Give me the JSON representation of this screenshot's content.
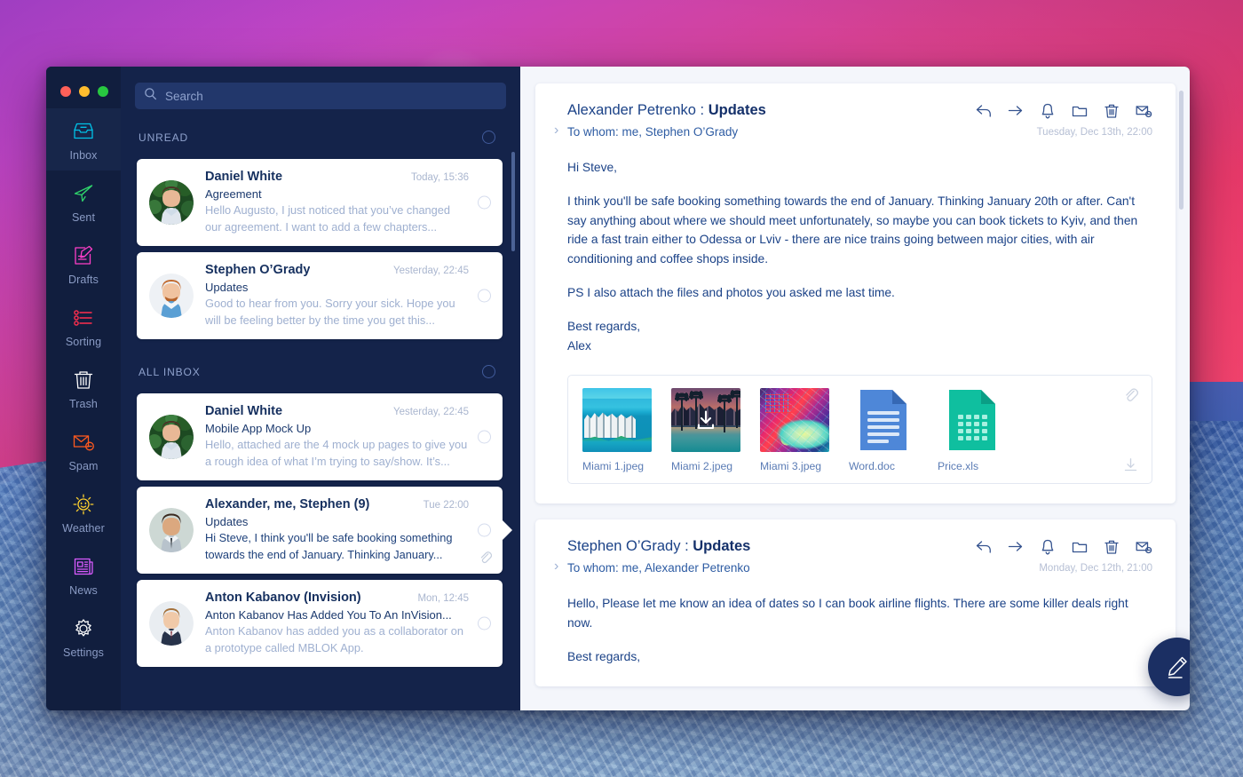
{
  "window": {
    "traffic_lights": [
      "close",
      "minimize",
      "zoom"
    ],
    "colors": {
      "sidebar_bg": "#111e3e",
      "list_bg": "#14234a",
      "reading_bg": "#f4f6fb",
      "accent_inbox": "#00c2e8",
      "accent_sent": "#2fd36b",
      "accent_drafts": "#ff3ec8",
      "accent_sorting": "#ff2e4e",
      "accent_trash": "#ffffff",
      "accent_spam": "#ff5a1f",
      "accent_weather": "#ffd22e",
      "accent_news": "#d95aff",
      "accent_settings": "#ffffff",
      "fab_bg": "#1b2f63"
    }
  },
  "sidebar": {
    "items": [
      {
        "label": "Inbox",
        "icon": "inbox-icon",
        "active": true
      },
      {
        "label": "Sent",
        "icon": "sent-icon",
        "active": false
      },
      {
        "label": "Drafts",
        "icon": "drafts-icon",
        "active": false
      },
      {
        "label": "Sorting",
        "icon": "sorting-icon",
        "active": false
      },
      {
        "label": "Trash",
        "icon": "trash-icon",
        "active": false
      },
      {
        "label": "Spam",
        "icon": "spam-icon",
        "active": false
      },
      {
        "label": "Weather",
        "icon": "weather-icon",
        "active": false
      },
      {
        "label": "News",
        "icon": "news-icon",
        "active": false
      },
      {
        "label": "Settings",
        "icon": "settings-icon",
        "active": false
      }
    ]
  },
  "search": {
    "placeholder": "Search",
    "value": "",
    "icon": "search-icon"
  },
  "message_list": {
    "sections": [
      {
        "title": "UNREAD",
        "messages": [
          {
            "from": "Daniel White",
            "time": "Today, 15:36",
            "subject": "Agreement",
            "preview": "Hello Augusto, I just noticed that you’ve changed our agreement. I want to add a few chapters...",
            "selected": false,
            "has_attachment": false
          },
          {
            "from": "Stephen O’Grady",
            "time": "Yesterday, 22:45",
            "subject": "Updates",
            "preview": "Good to hear from you.  Sorry your sick. Hope you will be feeling better by the time you get this...",
            "selected": false,
            "has_attachment": false
          }
        ]
      },
      {
        "title": "ALL INBOX",
        "messages": [
          {
            "from": "Daniel White",
            "time": "Yesterday, 22:45",
            "subject": "Mobile App Mock Up",
            "preview": "Hello, attached are the 4 mock up pages to give you a rough idea of what I’m trying to say/show. It’s...",
            "selected": false,
            "has_attachment": false
          },
          {
            "from": "Alexander, me, Stephen (9)",
            "time": "Tue 22:00",
            "subject": "Updates",
            "preview": "Hi Steve, I think you'll be safe booking something towards the end of January. Thinking January...",
            "selected": true,
            "has_attachment": true
          },
          {
            "from": "Anton Kabanov (Invision)",
            "time": "Mon, 12:45",
            "subject": "Anton Kabanov Has Added You To An InVision...",
            "preview": "Anton Kabanov has added you as a collaborator on a prototype called MBLOK App.",
            "selected": false,
            "has_attachment": false
          }
        ]
      }
    ]
  },
  "reading_pane": {
    "toolbar_icons": [
      "reply-icon",
      "forward-icon",
      "bell-icon",
      "folder-icon",
      "trash-icon",
      "mark-unread-icon"
    ],
    "emails": [
      {
        "sender": "Alexander Petrenko",
        "separator": " : ",
        "subject": "Updates",
        "to_label": "To whom: me, Stephen O’Grady",
        "date": "Tuesday, Dec 13th, 22:00",
        "paragraphs": [
          "Hi Steve,",
          "I think you'll be safe booking something towards the end of January.  Thinking January 20th or after.  Can't say anything about where we should meet unfortunately, so maybe you can book tickets to Kyiv, and then ride a fast train either to Odessa or Lviv - there are nice trains going between major cities, with air conditioning and coffee shops inside.",
          "PS I also attach the files and photos you asked me last time.",
          "Best regards,\nAlex"
        ],
        "attachments": [
          {
            "name": "Miami 1.jpeg",
            "kind": "image",
            "thumb": "miami1",
            "downloading": false
          },
          {
            "name": "Miami 2.jpeg",
            "kind": "image",
            "thumb": "miami2",
            "downloading": true
          },
          {
            "name": "Miami 3.jpeg",
            "kind": "image",
            "thumb": "miami3",
            "downloading": false
          },
          {
            "name": "Word.doc",
            "kind": "doc",
            "thumb": "word",
            "downloading": false
          },
          {
            "name": "Price.xls",
            "kind": "xls",
            "thumb": "excel",
            "downloading": false
          }
        ]
      },
      {
        "sender": "Stephen O’Grady",
        "separator": " : ",
        "subject": "Updates",
        "to_label": "To whom: me, Alexander Petrenko",
        "date": "Monday, Dec 12th, 21:00",
        "paragraphs": [
          "Hello, Please let me know an idea of dates so I can book airline flights.  There are some killer deals right now.",
          "Best regards,"
        ],
        "attachments": []
      }
    ]
  },
  "compose": {
    "label": "Compose",
    "icon": "pencil-icon"
  }
}
